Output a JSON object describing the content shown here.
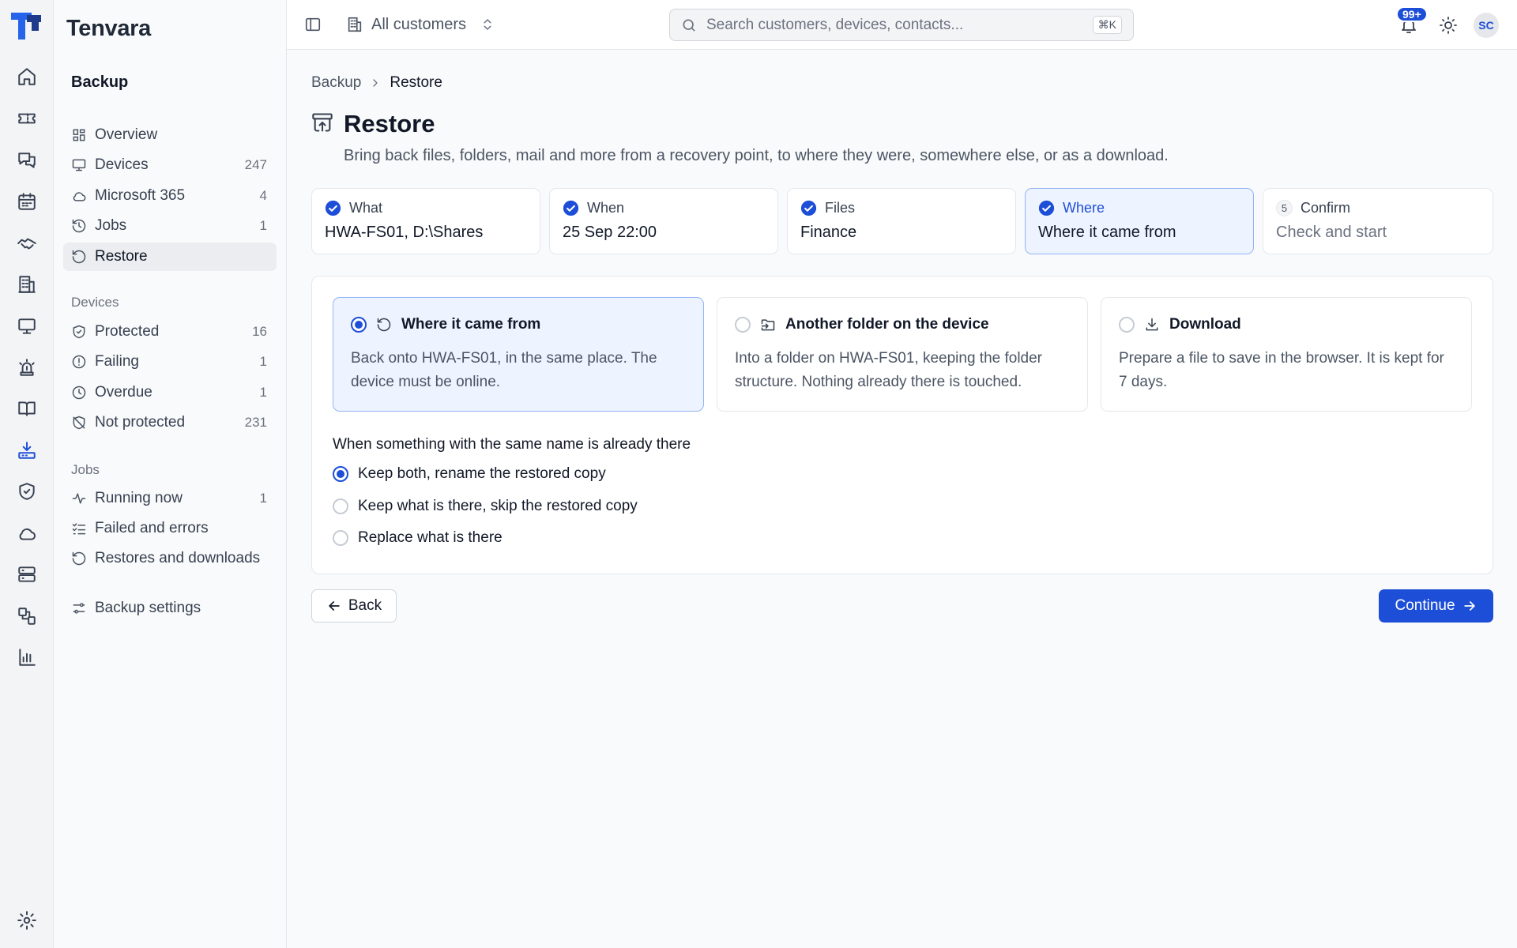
{
  "app": {
    "brand": "Tenvara",
    "accent_color": "#1d4ed8"
  },
  "rail": {
    "items": [
      {
        "icon": "home-icon"
      },
      {
        "icon": "ticket-icon"
      },
      {
        "icon": "chat-icon"
      },
      {
        "icon": "calendar-icon"
      },
      {
        "icon": "handshake-icon"
      },
      {
        "icon": "building-icon"
      },
      {
        "icon": "monitor-icon"
      },
      {
        "icon": "alarm-icon"
      },
      {
        "icon": "book-icon"
      },
      {
        "icon": "backup-download-icon",
        "active": true
      },
      {
        "icon": "shield-icon"
      },
      {
        "icon": "cloud-icon"
      },
      {
        "icon": "server-icon"
      },
      {
        "icon": "integrations-icon"
      },
      {
        "icon": "chart-icon"
      }
    ],
    "settings_icon": "gear-icon"
  },
  "sidebar": {
    "heading": "Backup",
    "top_items": [
      {
        "label": "Overview",
        "icon": "grid-icon",
        "count": ""
      },
      {
        "label": "Devices",
        "icon": "monitor-icon",
        "count": "247"
      },
      {
        "label": "Microsoft 365",
        "icon": "cloud-icon",
        "count": "4"
      },
      {
        "label": "Jobs",
        "icon": "history-icon",
        "count": "1"
      },
      {
        "label": "Restore",
        "icon": "restore-icon",
        "count": "",
        "active": true
      }
    ],
    "devices_group": {
      "label": "Devices",
      "items": [
        {
          "label": "Protected",
          "icon": "shield-check-icon",
          "count": "16"
        },
        {
          "label": "Failing",
          "icon": "alert-circle-icon",
          "count": "1"
        },
        {
          "label": "Overdue",
          "icon": "clock-icon",
          "count": "1"
        },
        {
          "label": "Not protected",
          "icon": "shield-off-icon",
          "count": "231"
        }
      ]
    },
    "jobs_group": {
      "label": "Jobs",
      "items": [
        {
          "label": "Running now",
          "icon": "activity-icon",
          "count": "1"
        },
        {
          "label": "Failed and errors",
          "icon": "list-check-icon",
          "count": ""
        },
        {
          "label": "Restores and downloads",
          "icon": "restore-icon",
          "count": ""
        }
      ]
    },
    "settings_item": {
      "label": "Backup settings",
      "icon": "sliders-icon"
    }
  },
  "topbar": {
    "customer_selector": "All customers",
    "search_placeholder": "Search customers, devices, contacts...",
    "search_shortcut": "⌘K",
    "notification_badge": "99+",
    "avatar_initials": "SC"
  },
  "breadcrumb": {
    "parent": "Backup",
    "current": "Restore"
  },
  "page": {
    "title": "Restore",
    "subtitle": "Bring back files, folders, mail and more from a recovery point, to where they were, somewhere else, or as a download."
  },
  "steps": [
    {
      "label": "What",
      "value": "HWA-FS01, D:\\Shares",
      "state": "done"
    },
    {
      "label": "When",
      "value": "25 Sep 22:00",
      "state": "done"
    },
    {
      "label": "Files",
      "value": "Finance",
      "state": "done"
    },
    {
      "label": "Where",
      "value": "Where it came from",
      "state": "current"
    },
    {
      "label": "Confirm",
      "value": "Check and start",
      "state": "pending",
      "number": "5"
    }
  ],
  "destinations": [
    {
      "title": "Where it came from",
      "icon": "restore-icon",
      "description": "Back onto HWA-FS01, in the same place. The device must be online.",
      "selected": true
    },
    {
      "title": "Another folder on the device",
      "icon": "folder-input-icon",
      "description": "Into a folder on HWA-FS01, keeping the folder structure. Nothing already there is touched.",
      "selected": false
    },
    {
      "title": "Download",
      "icon": "download-icon",
      "description": "Prepare a file to save in the browser. It is kept for 7 days.",
      "selected": false
    }
  ],
  "conflict": {
    "question": "When something with the same name is already there",
    "options": [
      {
        "label": "Keep both, rename the restored copy",
        "selected": true
      },
      {
        "label": "Keep what is there, skip the restored copy",
        "selected": false
      },
      {
        "label": "Replace what is there",
        "selected": false
      }
    ]
  },
  "actions": {
    "back": "Back",
    "continue": "Continue"
  }
}
